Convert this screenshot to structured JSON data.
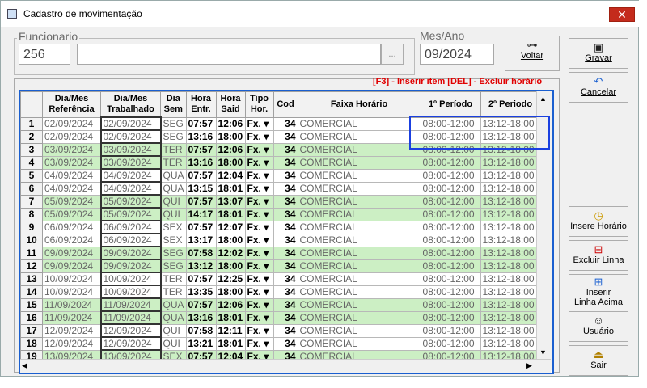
{
  "window": {
    "title": "Cadastro de movimentação",
    "close_label": "✕"
  },
  "employee": {
    "label": "Funcionario",
    "id": "256",
    "name": "",
    "lookup_label": "..."
  },
  "period": {
    "label": "Mes/Ano",
    "value": "09/2024"
  },
  "buttons": {
    "voltar": {
      "label": "Voltar",
      "icon": "binoculars-icon"
    },
    "gravar": {
      "label": "Gravar",
      "icon": "floppy-disk-icon"
    },
    "cancelar": {
      "label": "Cancelar",
      "icon": "undo-icon"
    },
    "insere_horario": {
      "label": "Insere Horário",
      "icon": "clock-icon"
    },
    "excluir_linha": {
      "label": "Excluir Linha",
      "icon": "delete-row-icon"
    },
    "inserir_linha": {
      "label": "Inserir Linha Acima",
      "icon": "insert-row-icon"
    },
    "usuario": {
      "label": "Usuário",
      "icon": "users-icon"
    },
    "sair": {
      "label": "Sair",
      "icon": "exit-door-icon"
    }
  },
  "hint": "[F3] - Inserir item [DEL] - Excluir horário",
  "grid": {
    "columns": [
      "Dia/Mes Referência",
      "Dia/Mes Trabalhado",
      "Dia Sem",
      "Hora Entr.",
      "Hora Said",
      "Tipo Hor.",
      "Cod",
      "Faixa Horário",
      "1º Período",
      "2º Periodo"
    ],
    "colors": {
      "highlight": "#ccefc4",
      "selection": "#1a40e0"
    },
    "rows": [
      {
        "n": "1",
        "ref": "02/09/2024",
        "trab": "02/09/2024",
        "dia": "SEG",
        "ent": "07:57",
        "sai": "12:06",
        "tipo": "Fx.",
        "cod": "34",
        "faixa": "COMERCIAL",
        "p1": "08:00-12:00",
        "p2": "13:12-18:00",
        "hl": false
      },
      {
        "n": "2",
        "ref": "02/09/2024",
        "trab": "02/09/2024",
        "dia": "SEG",
        "ent": "13:16",
        "sai": "18:00",
        "tipo": "Fx.",
        "cod": "34",
        "faixa": "COMERCIAL",
        "p1": "08:00-12:00",
        "p2": "13:12-18:00",
        "hl": false
      },
      {
        "n": "3",
        "ref": "03/09/2024",
        "trab": "03/09/2024",
        "dia": "TER",
        "ent": "07:57",
        "sai": "12:06",
        "tipo": "Fx.",
        "cod": "34",
        "faixa": "COMERCIAL",
        "p1": "08:00-12:00",
        "p2": "13:12-18:00",
        "hl": true
      },
      {
        "n": "4",
        "ref": "03/09/2024",
        "trab": "03/09/2024",
        "dia": "TER",
        "ent": "13:16",
        "sai": "18:00",
        "tipo": "Fx.",
        "cod": "34",
        "faixa": "COMERCIAL",
        "p1": "08:00-12:00",
        "p2": "13:12-18:00",
        "hl": true
      },
      {
        "n": "5",
        "ref": "04/09/2024",
        "trab": "04/09/2024",
        "dia": "QUA",
        "ent": "07:57",
        "sai": "12:04",
        "tipo": "Fx.",
        "cod": "34",
        "faixa": "COMERCIAL",
        "p1": "08:00-12:00",
        "p2": "13:12-18:00",
        "hl": false
      },
      {
        "n": "6",
        "ref": "04/09/2024",
        "trab": "04/09/2024",
        "dia": "QUA",
        "ent": "13:15",
        "sai": "18:01",
        "tipo": "Fx.",
        "cod": "34",
        "faixa": "COMERCIAL",
        "p1": "08:00-12:00",
        "p2": "13:12-18:00",
        "hl": false
      },
      {
        "n": "7",
        "ref": "05/09/2024",
        "trab": "05/09/2024",
        "dia": "QUI",
        "ent": "07:57",
        "sai": "13:07",
        "tipo": "Fx.",
        "cod": "34",
        "faixa": "COMERCIAL",
        "p1": "08:00-12:00",
        "p2": "13:12-18:00",
        "hl": true
      },
      {
        "n": "8",
        "ref": "05/09/2024",
        "trab": "05/09/2024",
        "dia": "QUI",
        "ent": "14:17",
        "sai": "18:01",
        "tipo": "Fx.",
        "cod": "34",
        "faixa": "COMERCIAL",
        "p1": "08:00-12:00",
        "p2": "13:12-18:00",
        "hl": true
      },
      {
        "n": "9",
        "ref": "06/09/2024",
        "trab": "06/09/2024",
        "dia": "SEX",
        "ent": "07:57",
        "sai": "12:07",
        "tipo": "Fx.",
        "cod": "34",
        "faixa": "COMERCIAL",
        "p1": "08:00-12:00",
        "p2": "13:12-18:00",
        "hl": false
      },
      {
        "n": "10",
        "ref": "06/09/2024",
        "trab": "06/09/2024",
        "dia": "SEX",
        "ent": "13:17",
        "sai": "18:00",
        "tipo": "Fx.",
        "cod": "34",
        "faixa": "COMERCIAL",
        "p1": "08:00-12:00",
        "p2": "13:12-18:00",
        "hl": false
      },
      {
        "n": "11",
        "ref": "09/09/2024",
        "trab": "09/09/2024",
        "dia": "SEG",
        "ent": "07:58",
        "sai": "12:02",
        "tipo": "Fx.",
        "cod": "34",
        "faixa": "COMERCIAL",
        "p1": "08:00-12:00",
        "p2": "13:12-18:00",
        "hl": true
      },
      {
        "n": "12",
        "ref": "09/09/2024",
        "trab": "09/09/2024",
        "dia": "SEG",
        "ent": "13:12",
        "sai": "18:00",
        "tipo": "Fx.",
        "cod": "34",
        "faixa": "COMERCIAL",
        "p1": "08:00-12:00",
        "p2": "13:12-18:00",
        "hl": true
      },
      {
        "n": "13",
        "ref": "10/09/2024",
        "trab": "10/09/2024",
        "dia": "TER",
        "ent": "07:57",
        "sai": "12:25",
        "tipo": "Fx.",
        "cod": "34",
        "faixa": "COMERCIAL",
        "p1": "08:00-12:00",
        "p2": "13:12-18:00",
        "hl": false
      },
      {
        "n": "14",
        "ref": "10/09/2024",
        "trab": "10/09/2024",
        "dia": "TER",
        "ent": "13:35",
        "sai": "18:00",
        "tipo": "Fx.",
        "cod": "34",
        "faixa": "COMERCIAL",
        "p1": "08:00-12:00",
        "p2": "13:12-18:00",
        "hl": false
      },
      {
        "n": "15",
        "ref": "11/09/2024",
        "trab": "11/09/2024",
        "dia": "QUA",
        "ent": "07:57",
        "sai": "12:06",
        "tipo": "Fx.",
        "cod": "34",
        "faixa": "COMERCIAL",
        "p1": "08:00-12:00",
        "p2": "13:12-18:00",
        "hl": true
      },
      {
        "n": "16",
        "ref": "11/09/2024",
        "trab": "11/09/2024",
        "dia": "QUA",
        "ent": "13:16",
        "sai": "18:01",
        "tipo": "Fx.",
        "cod": "34",
        "faixa": "COMERCIAL",
        "p1": "08:00-12:00",
        "p2": "13:12-18:00",
        "hl": true
      },
      {
        "n": "17",
        "ref": "12/09/2024",
        "trab": "12/09/2024",
        "dia": "QUI",
        "ent": "07:58",
        "sai": "12:11",
        "tipo": "Fx.",
        "cod": "34",
        "faixa": "COMERCIAL",
        "p1": "08:00-12:00",
        "p2": "13:12-18:00",
        "hl": false
      },
      {
        "n": "18",
        "ref": "12/09/2024",
        "trab": "12/09/2024",
        "dia": "QUI",
        "ent": "13:21",
        "sai": "18:01",
        "tipo": "Fx.",
        "cod": "34",
        "faixa": "COMERCIAL",
        "p1": "08:00-12:00",
        "p2": "13:12-18:00",
        "hl": false
      },
      {
        "n": "19",
        "ref": "13/09/2024",
        "trab": "13/09/2024",
        "dia": "SEX",
        "ent": "07:57",
        "sai": "12:04",
        "tipo": "Fx.",
        "cod": "34",
        "faixa": "COMERCIAL",
        "p1": "08:00-12:00",
        "p2": "13:12-18:00",
        "hl": true
      }
    ]
  }
}
